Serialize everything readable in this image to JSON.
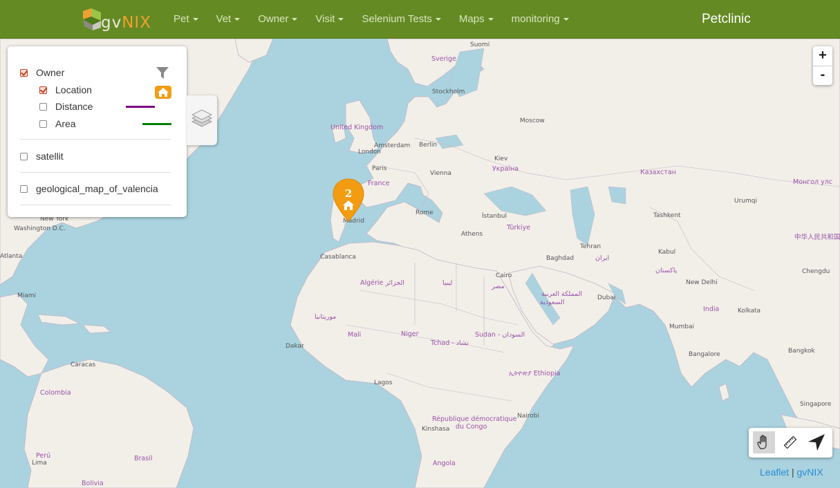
{
  "app": {
    "brand_prefix": "gv",
    "brand_suffix": "NIX",
    "title": "Petclinic"
  },
  "nav": {
    "items": [
      {
        "label": "Pet"
      },
      {
        "label": "Vet"
      },
      {
        "label": "Owner"
      },
      {
        "label": "Visit"
      },
      {
        "label": "Selenium Tests"
      },
      {
        "label": "Maps"
      },
      {
        "label": "monitoring"
      }
    ]
  },
  "layers": {
    "owner": {
      "label": "Owner",
      "checked": true,
      "icon": "filter-icon"
    },
    "location": {
      "label": "Location",
      "checked": true,
      "icon": "home-icon"
    },
    "distance": {
      "label": "Distance",
      "checked": false,
      "color": "#800080"
    },
    "area": {
      "label": "Area",
      "checked": false,
      "color": "#008000"
    },
    "satellit": {
      "label": "satellit",
      "checked": false
    },
    "geological": {
      "label": "geological_map_of_valencia",
      "checked": false
    }
  },
  "zoom": {
    "in_label": "+",
    "out_label": "-"
  },
  "toolbar": {
    "tools": [
      {
        "name": "pan-tool",
        "icon": "hand-icon",
        "active": true
      },
      {
        "name": "measure-tool",
        "icon": "ruler-icon",
        "active": false
      },
      {
        "name": "locate-tool",
        "icon": "navigation-arrow-icon",
        "active": false
      }
    ]
  },
  "marker": {
    "count": "2",
    "icon": "home-icon",
    "color": "#f39c12"
  },
  "attribution": {
    "leaflet": "Leaflet",
    "separator": "|",
    "gvnix": "gvNIX"
  },
  "map_labels": {
    "suomi": "Suomi",
    "sverige": "Sverige",
    "stockholm": "Stockholm",
    "moscow": "Moscow",
    "uk": "United Kingdom",
    "london": "London",
    "amsterdam": "Amsterdam",
    "berlin": "Berlin",
    "kiev": "Kiev",
    "ukraina": "Україна",
    "paris": "Paris",
    "france": "France",
    "vienna": "Vienna",
    "kazakhstan": "Казахстан",
    "mongolia": "Монгол улс",
    "urumqi": "Urumqi",
    "tashkent": "Tashkent",
    "madrid": "Madrid",
    "rome": "Rome",
    "istanbul": "İstanbul",
    "turkiye": "Türkiye",
    "athens": "Athens",
    "tehran": "Tehran",
    "iran": "ایران",
    "kabul": "Kabul",
    "china": "中华人民共和国",
    "newyork": "New York",
    "washington": "Washington D.C.",
    "atlanta": "Atlanta",
    "casablanca": "Casablanca",
    "algerie": "Algérie الجزائر",
    "libya": "ليبيا",
    "baghdad": "Baghdad",
    "pakistan": "پاکستان",
    "chengdu": "Chengdu",
    "newdelhi": "New Delhi",
    "cairo": "Cairo",
    "egypt": "مصر",
    "saudi1": "المملكة العربية",
    "saudi2": "السعودية",
    "dubai": "Dubai",
    "india": "India",
    "kolkata": "Kolkata",
    "miami": "Miami",
    "mauritania": "موريتانيا",
    "mali": "Mali",
    "niger": "Niger",
    "tchad": "Tchad - تشاد",
    "sudan": "Sudan - السودان",
    "mumbai": "Mumbai",
    "dakar": "Dakar",
    "ethiopia": "ኢትዮጵያ Ethiopia",
    "bangalore": "Bangalore",
    "bangkok": "Bangkok",
    "caracas": "Caracas",
    "colombia": "Colombia",
    "lagos": "Lagos",
    "singapore": "Singapore",
    "rdc1": "République démocratique",
    "rdc2": "du Congo",
    "nairobi": "Nairobi",
    "kinshasa": "Kinshasa",
    "peru": "Perú",
    "lima": "Lima",
    "brasil": "Brasil",
    "angola": "Angola",
    "bolivia": "Bolivia"
  }
}
